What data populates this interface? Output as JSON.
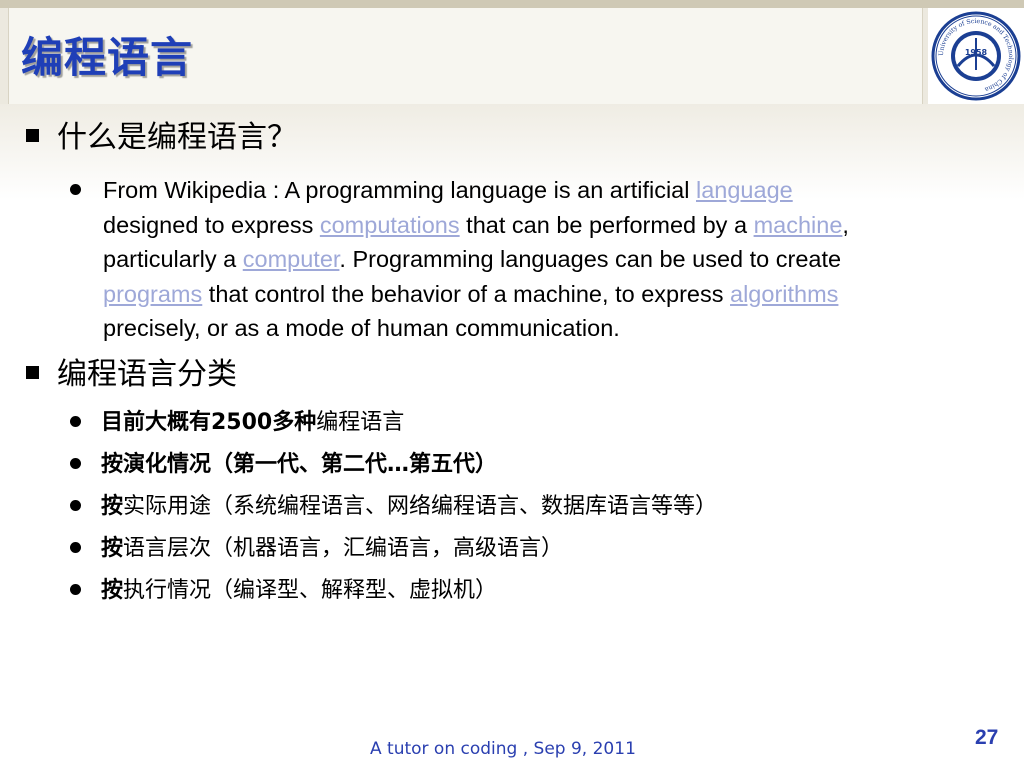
{
  "slide": {
    "title": "编程语言",
    "sections": [
      {
        "heading": "什么是编程语言？",
        "paragraph": {
          "lines": [
            [
              {
                "t": "From Wikipedia : A programming language is an artificial "
              },
              {
                "t": "language",
                "link": true
              }
            ],
            [
              {
                "t": "designed to express "
              },
              {
                "t": "computations",
                "link": true
              },
              {
                "t": " that can be performed by a "
              },
              {
                "t": "machine",
                "link": true
              },
              {
                "t": ","
              }
            ],
            [
              {
                "t": "particularly a "
              },
              {
                "t": "computer",
                "link": true
              },
              {
                "t": ". Programming languages can be used to create"
              }
            ],
            [
              {
                "t": "programs",
                "link": true
              },
              {
                "t": " that control the behavior of a machine, to express "
              },
              {
                "t": "algorithms",
                "link": true
              }
            ],
            [
              {
                "t": "precisely, or as a mode of human communication."
              }
            ]
          ]
        }
      },
      {
        "heading": "编程语言分类",
        "items": [
          {
            "bold": "目前大概有2500多种",
            "rest": "编程语言"
          },
          {
            "bold": "按演化情况（第一代、第二代…第五代）",
            "rest": ""
          },
          {
            "bold": "按",
            "rest": "实际用途（系统编程语言、网络编程语言、数据库语言等等）"
          },
          {
            "bold": "按",
            "rest": "语言层次（机器语言，汇编语言，高级语言）"
          },
          {
            "bold": "按",
            "rest": "执行情况（编译型、解释型、虚拟机）"
          }
        ]
      }
    ],
    "footer": "A tutor on coding , Sep 9, 2011",
    "page_number": "27",
    "logo": {
      "year": "1958",
      "ring_text": "University of Science and Technology of China",
      "color": "#1b3f93"
    }
  }
}
